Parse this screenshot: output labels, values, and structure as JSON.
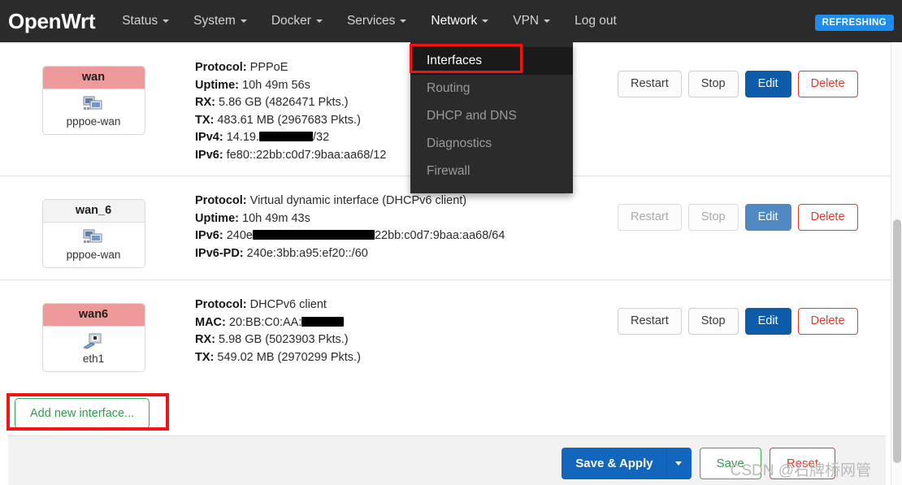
{
  "navbar": {
    "brand": "OpenWrt",
    "items": [
      {
        "label": "Status",
        "has_caret": true
      },
      {
        "label": "System",
        "has_caret": true
      },
      {
        "label": "Docker",
        "has_caret": true
      },
      {
        "label": "Services",
        "has_caret": true
      },
      {
        "label": "Network",
        "has_caret": true
      },
      {
        "label": "VPN",
        "has_caret": true
      },
      {
        "label": "Log out",
        "has_caret": false
      }
    ],
    "status_badge": "REFRESHING",
    "status_badge_color": "#1d8bef"
  },
  "dropdown": {
    "parent": "Network",
    "items": [
      {
        "label": "Interfaces",
        "active": true
      },
      {
        "label": "Routing",
        "active": false
      },
      {
        "label": "DHCP and DNS",
        "active": false
      },
      {
        "label": "Diagnostics",
        "active": false
      },
      {
        "label": "Firewall",
        "active": false
      }
    ],
    "highlight_color": "#f01414"
  },
  "interfaces": [
    {
      "name": "wan",
      "state": "up",
      "device_icon": "network-interface-icon",
      "device_label": "pppoe-wan",
      "details": [
        {
          "key": "Protocol:",
          "value": "PPPoE",
          "redacted": false
        },
        {
          "key": "Uptime:",
          "value": "10h 49m 56s",
          "redacted": false
        },
        {
          "key": "RX:",
          "value": "5.86 GB (4826471 Pkts.)",
          "redacted": false
        },
        {
          "key": "TX:",
          "value": "483.61 MB (2967683 Pkts.)",
          "redacted": false
        },
        {
          "key": "IPv4:",
          "value": "14.19.",
          "value_suffix": "/32",
          "redacted": true,
          "redact_size": "r1"
        },
        {
          "key": "IPv6:",
          "value": "fe80::22bb:c0d7:9baa:aa68/12",
          "redacted": false
        }
      ],
      "buttons": {
        "restart": "Restart",
        "stop": "Stop",
        "edit": "Edit",
        "delete": "Delete"
      },
      "buttons_muted": false
    },
    {
      "name": "wan_6",
      "state": "neutral",
      "device_icon": "network-interface-icon",
      "device_label": "pppoe-wan",
      "details": [
        {
          "key": "Protocol:",
          "value": "Virtual dynamic interface (DHCPv6 client)",
          "redacted": false
        },
        {
          "key": "Uptime:",
          "value": "10h 49m 43s",
          "redacted": false
        },
        {
          "key": "IPv6:",
          "value": "240e",
          "value_suffix": "22bb:c0d7:9baa:aa68/64",
          "redacted": true,
          "redact_size": "r2"
        },
        {
          "key": "IPv6-PD:",
          "value": "240e:3bb:a95:ef20::/60",
          "redacted": false
        }
      ],
      "buttons": {
        "restart": "Restart",
        "stop": "Stop",
        "edit": "Edit",
        "delete": "Delete"
      },
      "buttons_muted": true
    },
    {
      "name": "wan6",
      "state": "up",
      "device_icon": "ethernet-icon",
      "device_label": "eth1",
      "details": [
        {
          "key": "Protocol:",
          "value": "DHCPv6 client",
          "redacted": false
        },
        {
          "key": "MAC:",
          "value": "20:BB:C0:AA:",
          "value_suffix": "",
          "redacted": true,
          "redact_size": "r3"
        },
        {
          "key": "RX:",
          "value": "5.98 GB (5023903 Pkts.)",
          "redacted": false
        },
        {
          "key": "TX:",
          "value": "549.02 MB (2970299 Pkts.)",
          "redacted": false
        }
      ],
      "buttons": {
        "restart": "Restart",
        "stop": "Stop",
        "edit": "Edit",
        "delete": "Delete"
      },
      "buttons_muted": false
    }
  ],
  "add_interface": {
    "label": "Add new interface...",
    "highlight_color": "#f01414"
  },
  "footer": {
    "save_apply": "Save & Apply",
    "save": "Save",
    "reset": "Reset"
  },
  "watermark": "CSDN @石牌桥网管"
}
